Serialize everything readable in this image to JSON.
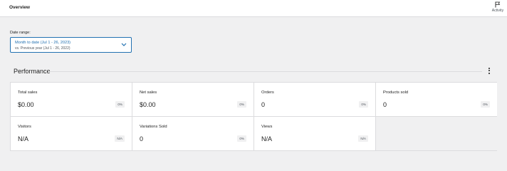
{
  "header": {
    "title": "Overview",
    "activity_label": "Activity"
  },
  "date_range": {
    "label": "Date range:",
    "primary": "Month to date (Jul 1 - 26, 2023)",
    "secondary": "vs. Previous year (Jul 1 - 26, 2022)"
  },
  "performance": {
    "title": "Performance",
    "stats": [
      {
        "label": "Total sales",
        "value": "$0.00",
        "delta": "0%"
      },
      {
        "label": "Net sales",
        "value": "$0.00",
        "delta": "0%"
      },
      {
        "label": "Orders",
        "value": "0",
        "delta": "0%"
      },
      {
        "label": "Products sold",
        "value": "0",
        "delta": "0%"
      },
      {
        "label": "Visitors",
        "value": "N/A",
        "delta": "N/A"
      },
      {
        "label": "Variations Sold",
        "value": "0",
        "delta": "0%"
      },
      {
        "label": "Views",
        "value": "N/A",
        "delta": "N/A"
      }
    ]
  },
  "icons": {
    "activity": "flag-icon",
    "range": "chevron-down-icon",
    "menu": "more-vertical-icon"
  },
  "colors": {
    "accent": "#2271b1",
    "background": "#f0f0f1",
    "card": "#ffffff"
  }
}
